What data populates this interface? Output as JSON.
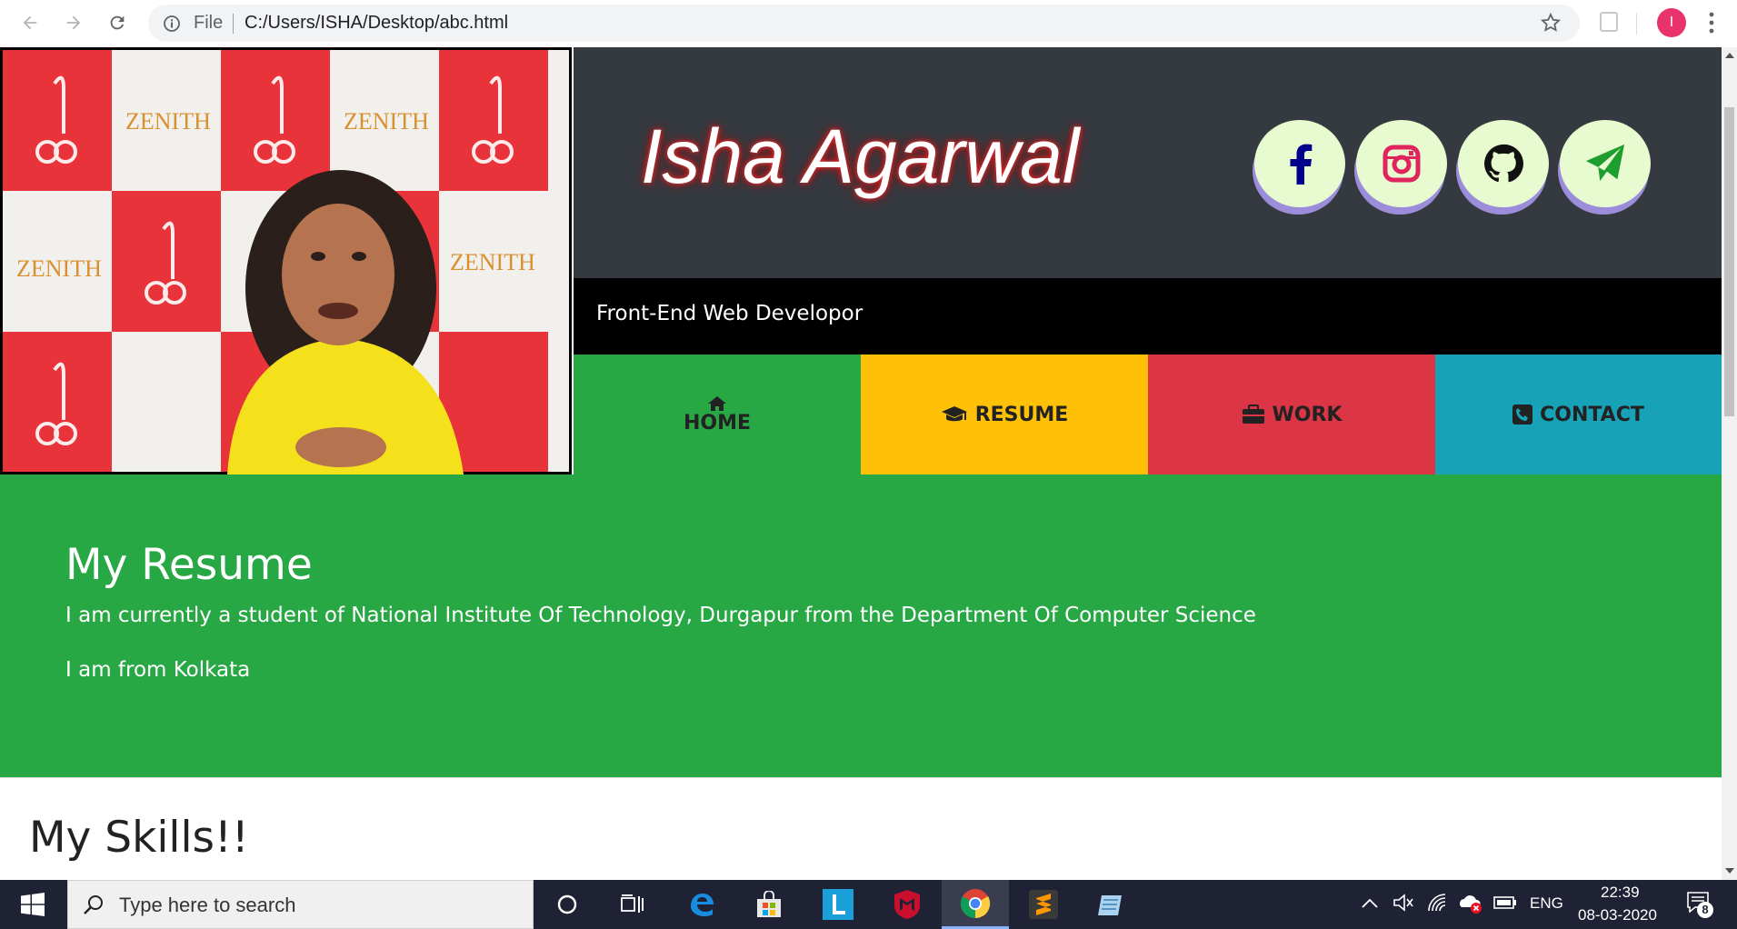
{
  "browser": {
    "omnibox_scheme": "File",
    "url": "C:/Users/ISHA/Desktop/abc.html",
    "profile_initial": "I"
  },
  "header": {
    "name": "Isha Agarwal",
    "tagline": "Front-End Web Developor",
    "photo_texts": {
      "brand": "ZENITH"
    }
  },
  "social": [
    {
      "icon": "facebook-icon",
      "color": "#00008b"
    },
    {
      "icon": "instagram-icon",
      "color": "#e0245e"
    },
    {
      "icon": "github-icon",
      "color": "#111111"
    },
    {
      "icon": "send-icon",
      "color": "#1e9e2e"
    }
  ],
  "nav": {
    "home": "HOME",
    "resume": "RESUME",
    "work": "WORK",
    "contact": "CONTACT"
  },
  "resume": {
    "title": "My Resume",
    "line1": "I am currently a student of National Institute Of Technology, Durgapur from the Department Of Computer Science",
    "line2": "I am from Kolkata"
  },
  "skills": {
    "title": "My Skills!!"
  },
  "taskbar": {
    "search_placeholder": "Type here to search",
    "language": "ENG",
    "time": "22:39",
    "date": "08-03-2020",
    "notification_count": "8"
  },
  "colors": {
    "home": "#28a745",
    "resume": "#ffc107",
    "work": "#dc3545",
    "contact": "#17a2b8",
    "header_dark": "#343a40"
  }
}
